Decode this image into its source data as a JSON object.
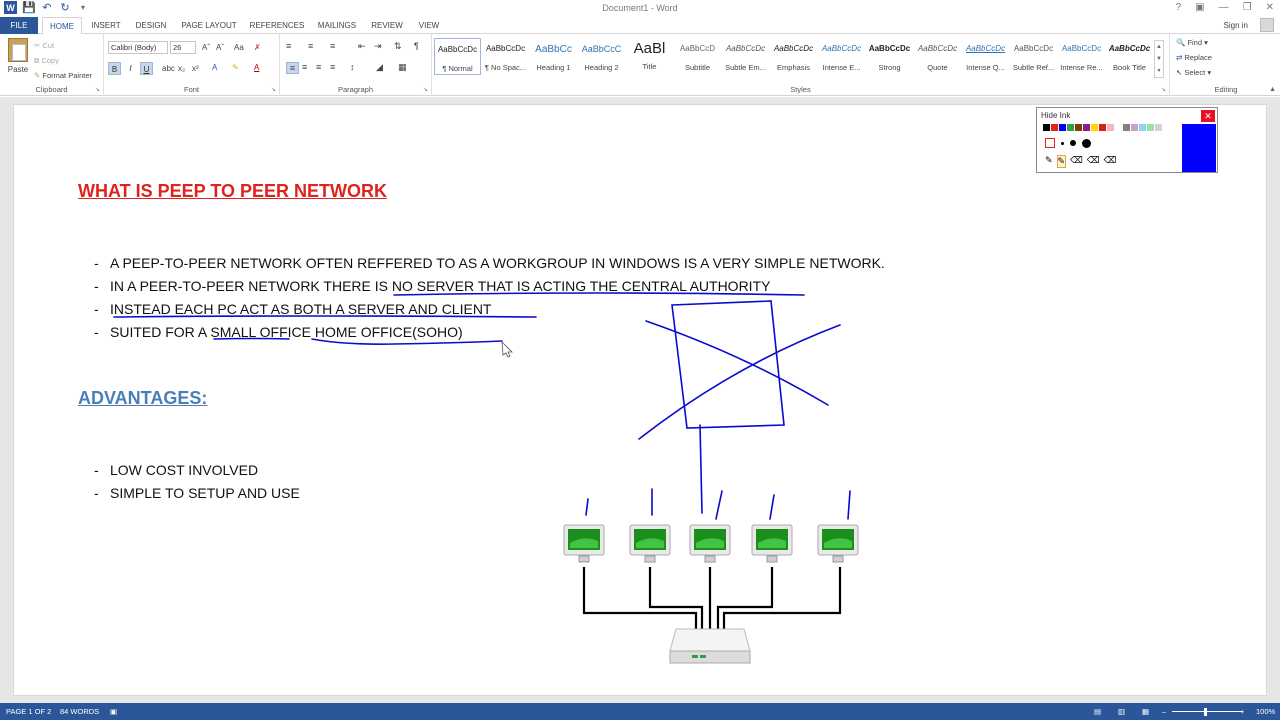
{
  "app": {
    "title": "Document1 - Word",
    "sign_in": "Sign in"
  },
  "tabs": [
    "FILE",
    "HOME",
    "INSERT",
    "DESIGN",
    "PAGE LAYOUT",
    "REFERENCES",
    "MAILINGS",
    "REVIEW",
    "VIEW"
  ],
  "ribbon": {
    "clipboard": {
      "label": "Clipboard",
      "paste": "Paste",
      "cut": "Cut",
      "copy": "Copy",
      "format_painter": "Format Painter"
    },
    "font": {
      "label": "Font",
      "font_name": "Calibri (Body)",
      "font_size": "26",
      "bold": "B",
      "italic": "I",
      "underline": "U"
    },
    "paragraph": {
      "label": "Paragraph"
    },
    "styles": {
      "label": "Styles",
      "items": [
        {
          "sample": "AaBbCcDc",
          "name": "¶ Normal"
        },
        {
          "sample": "AaBbCcDc",
          "name": "¶ No Spac..."
        },
        {
          "sample": "AaBbCc",
          "name": "Heading 1"
        },
        {
          "sample": "AaBbCcC",
          "name": "Heading 2"
        },
        {
          "sample": "AaBl",
          "name": "Title"
        },
        {
          "sample": "AaBbCcD",
          "name": "Subtitle"
        },
        {
          "sample": "AaBbCcDc",
          "name": "Subtle Em..."
        },
        {
          "sample": "AaBbCcDc",
          "name": "Emphasis"
        },
        {
          "sample": "AaBbCcDc",
          "name": "Intense E..."
        },
        {
          "sample": "AaBbCcDc",
          "name": "Strong"
        },
        {
          "sample": "AaBbCcDc",
          "name": "Quote"
        },
        {
          "sample": "AaBbCcDc",
          "name": "Intense Q..."
        },
        {
          "sample": "AaBbCcDc",
          "name": "Subtle Ref..."
        },
        {
          "sample": "AaBbCcDc",
          "name": "Intense Re..."
        },
        {
          "sample": "AaBbCcDc",
          "name": "Book Title"
        }
      ]
    },
    "editing": {
      "label": "Editing",
      "find": "Find",
      "replace": "Replace",
      "select": "Select"
    }
  },
  "ink_panel": {
    "title": "Hide Ink",
    "colors": [
      "#000000",
      "#e8211d",
      "#0000ff",
      "#2ea043",
      "#7b3f00",
      "#8b1a8b",
      "#ffd400",
      "#d91e18",
      "#f3b6c8",
      "#ffffff",
      "#7f7f7f",
      "#c8a2c8",
      "#8fd3f4",
      "#9be29b",
      "#d3d3d3"
    ],
    "selected_color": "#0000ff"
  },
  "document": {
    "heading1": "WHAT IS PEEP TO PEER NETWORK",
    "bullets1": [
      "A PEEP-TO-PEER NETWORK OFTEN REFFERED TO AS A WORKGROUP IN WINDOWS IS A VERY SIMPLE NETWORK.",
      "IN A PEER-TO-PEER NETWORK  THERE IS NO SERVER THAT IS  ACTING  THE CENTRAL AUTHORITY",
      "INSTEAD EACH PC ACT AS BOTH A SERVER AND CLIENT",
      "SUITED FOR A SMALL OFFICE HOME OFFICE(SOHO)"
    ],
    "heading2": "ADVANTAGES:",
    "bullets2": [
      "LOW COST INVOLVED",
      "SIMPLE TO SETUP AND USE"
    ]
  },
  "statusbar": {
    "page": "PAGE 1 OF 2",
    "words": "84 WORDS",
    "zoom": "100%"
  },
  "colors": {
    "accent": "#2b579a",
    "heading_red": "#e0221d",
    "heading_blue": "#4a7fb6",
    "ink": "#0a0ad0"
  }
}
